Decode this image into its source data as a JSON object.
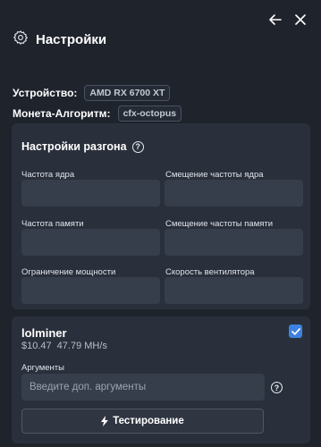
{
  "header": {
    "title": "Настройки",
    "icon": "gear-icon",
    "back_icon": "arrow-left-icon",
    "close_icon": "close-icon"
  },
  "device": {
    "label": "Устройство:",
    "value": "AMD RX 6700 XT"
  },
  "coin": {
    "label": "Монета-Алгоритм:",
    "value": "cfx-octopus"
  },
  "overclock": {
    "title": "Настройки разгона",
    "help_icon": "?",
    "fields": [
      {
        "label": "Частота ядра",
        "value": ""
      },
      {
        "label": "Смещение частоты ядра",
        "value": ""
      },
      {
        "label": "Частота памяти",
        "value": ""
      },
      {
        "label": "Смещение частоты памяти",
        "value": ""
      },
      {
        "label": "Ограничение мощности",
        "value": ""
      },
      {
        "label": "Скорость вентилятора",
        "value": ""
      }
    ]
  },
  "miner": {
    "name": "lolminer",
    "revenue": "$10.47",
    "hashrate": "47.79 MH/s",
    "checked": true,
    "args_label": "Аргументы",
    "args_placeholder": "Введите доп. аргументы",
    "args_help": "?",
    "test_button": "Тестирование",
    "test_icon": "lightning-icon"
  },
  "colors": {
    "background": "#1e232c",
    "panel": "#2a303b",
    "input": "#373e4b",
    "accent": "#3d82e0"
  }
}
